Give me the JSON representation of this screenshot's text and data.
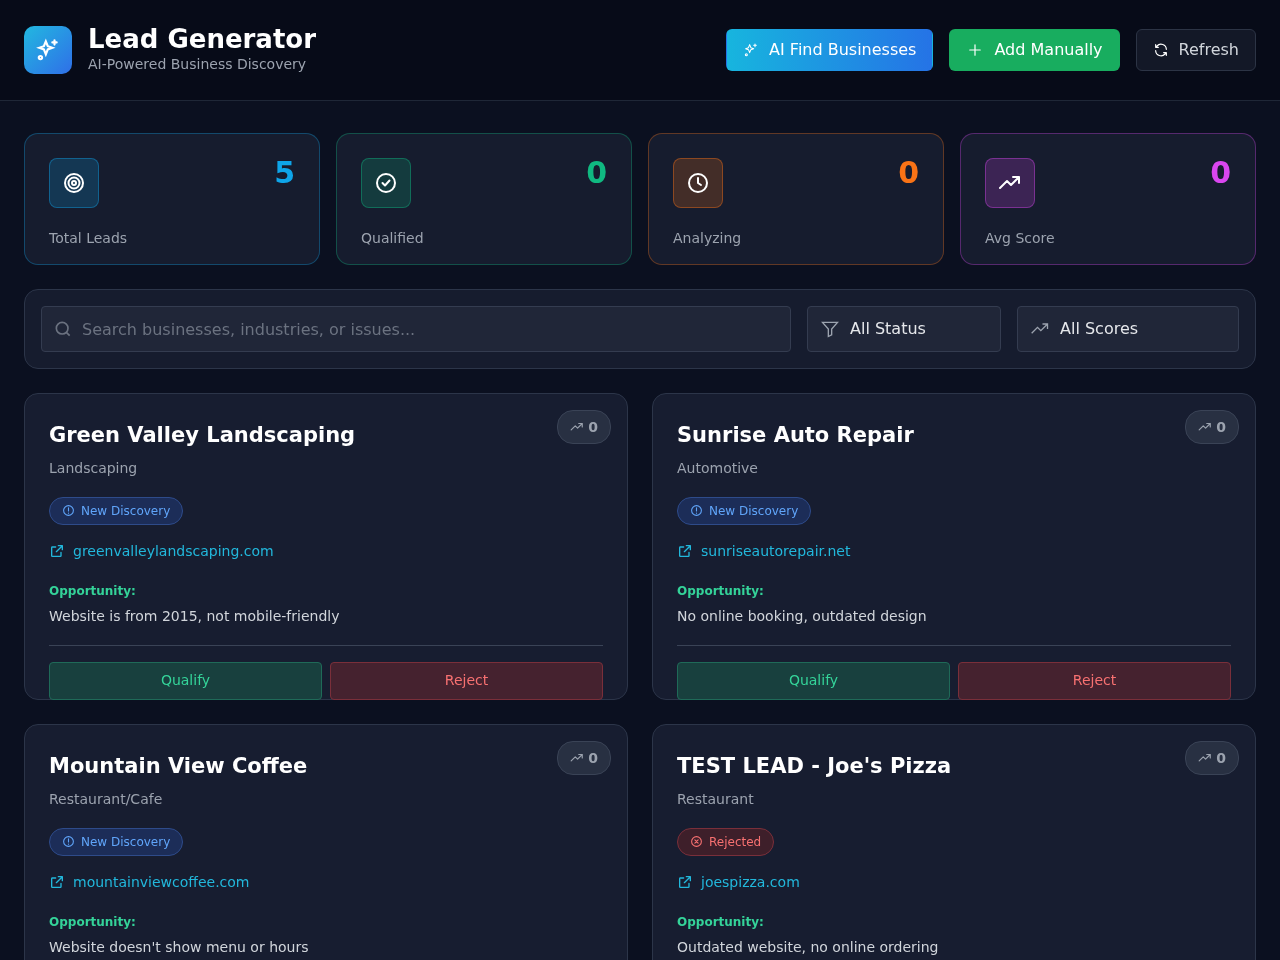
{
  "header": {
    "title": "Lead Generator",
    "subtitle": "AI-Powered Business Discovery",
    "buttons": [
      {
        "kind": "ai",
        "label": "AI Find Businesses"
      },
      {
        "kind": "add",
        "label": "Add Manually"
      },
      {
        "kind": "refresh",
        "label": "Refresh"
      }
    ]
  },
  "stats": [
    {
      "kind": "target",
      "value": "5",
      "label": "Total Leads",
      "color": "#0ea5e9"
    },
    {
      "kind": "check",
      "value": "0",
      "label": "Qualified",
      "color": "#10b981"
    },
    {
      "kind": "clock",
      "value": "0",
      "label": "Analyzing",
      "color": "#f97316"
    },
    {
      "kind": "trend",
      "value": "0",
      "label": "Avg Score",
      "color": "#d946ef"
    }
  ],
  "filters": {
    "search": {
      "placeholder": "Search businesses, industries, or issues..."
    },
    "status": "All Status",
    "scores": "All Scores"
  },
  "leads": [
    {
      "name": "Green Valley Landscaping",
      "industry": "Landscaping",
      "status": {
        "kind": "new",
        "label": "New Discovery"
      },
      "website": "greenvalleylandscaping.com",
      "score": "0",
      "opportunity_label": "Opportunity:",
      "opportunity": "Website is from 2015, not mobile-friendly",
      "actions": [
        "Qualify",
        "Reject"
      ]
    },
    {
      "name": "Sunrise Auto Repair",
      "industry": "Automotive",
      "status": {
        "kind": "new",
        "label": "New Discovery"
      },
      "website": "sunriseautorepair.net",
      "score": "0",
      "opportunity_label": "Opportunity:",
      "opportunity": "No online booking, outdated design",
      "actions": [
        "Qualify",
        "Reject"
      ]
    },
    {
      "name": "Mountain View Coffee",
      "industry": "Restaurant/Cafe",
      "status": {
        "kind": "new",
        "label": "New Discovery"
      },
      "website": "mountainviewcoffee.com",
      "score": "0",
      "opportunity_label": "Opportunity:",
      "opportunity": "Website doesn't show menu or hours"
    },
    {
      "name": "TEST LEAD - Joe's Pizza",
      "industry": "Restaurant",
      "status": {
        "kind": "rejected",
        "label": "Rejected"
      },
      "website": "joespizza.com",
      "score": "0",
      "opportunity_label": "Opportunity:",
      "opportunity": "Outdated website, no online ordering"
    }
  ]
}
